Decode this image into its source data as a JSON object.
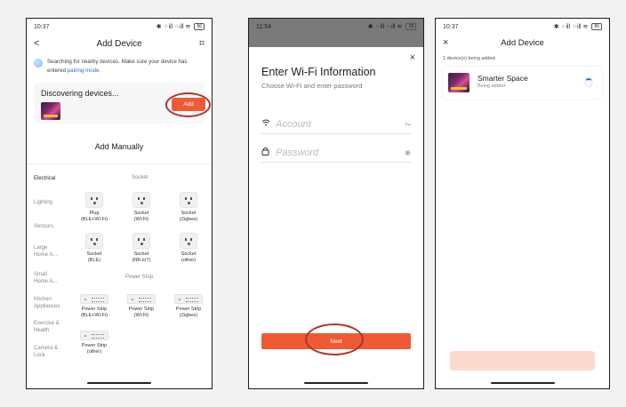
{
  "phone1": {
    "time": "10:37",
    "status_icons": "✱ ⁘ill ⁘ill ≋",
    "battery": "86",
    "title": "Add Device",
    "back": "<",
    "scan": "⌗",
    "scan_note_a": "Searching for nearby devices. Make sure your device has entered ",
    "scan_note_link": "pairing mode",
    "scan_note_b": ".",
    "discovering": "Discovering devices...",
    "add_label": "Add",
    "add_manually": "Add Manually",
    "categories": [
      "Electrical",
      "Lighting",
      "Sensors",
      "Large\nHome A...",
      "Small\nHome A...",
      "Kitchen\nAppliances",
      "Exercise &\nHealth",
      "Camera &\nLock"
    ],
    "section_socket": "Socket",
    "section_strip": "Power Strip",
    "sockets": [
      "Plug\n(BLE+Wi-Fi)",
      "Socket\n(Wi-Fi)",
      "Socket\n(Zigbee)",
      "Socket\n(BLE)",
      "Socket\n(NB-IoT)",
      "Socket\n(other)"
    ],
    "strips": [
      "Power Strip\n(BLE+Wi-Fi)",
      "Power Strip\n(Wi-Fi)",
      "Power Strip\n(Zigbee)",
      "Power Strip\n(other)"
    ]
  },
  "phone2": {
    "time": "11:54",
    "status_icons": "✱ ⁘ill ⁘ill ≋",
    "battery": "78",
    "close": "×",
    "title": "Enter Wi-Fi Information",
    "subtitle": "Choose Wi-Fi and enter password",
    "account_placeholder": "Account",
    "password_placeholder": "Password",
    "next_label": "Next"
  },
  "phone3": {
    "time": "10:37",
    "status_icons": "✱ ⁘ill ⁘ill ≋",
    "battery": "86",
    "close": "×",
    "title": "Add Device",
    "note": "1 device(s) being added",
    "device_name": "Smarter Space",
    "device_status": "Being added"
  }
}
